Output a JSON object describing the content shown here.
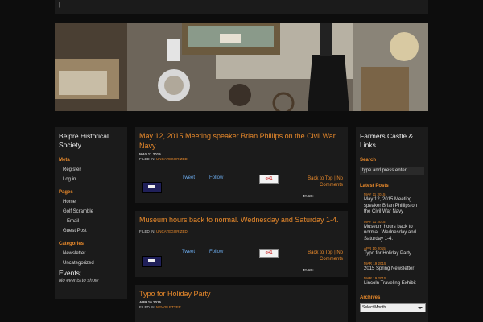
{
  "topbar": {
    "text": "|"
  },
  "left_sidebar": {
    "site_title": "Belpre Historical Society",
    "meta_title": "Meta",
    "meta_items": [
      "Register",
      "Log in"
    ],
    "pages_title": "Pages",
    "pages_items": [
      "Home",
      "Golf Scramble",
      "Email",
      "Guest Post"
    ],
    "categories_title": "Categories",
    "categories_items": [
      "Newsletter",
      "Uncategorized"
    ],
    "events_title": "Events;",
    "events_none": "No events to show"
  },
  "posts": [
    {
      "title": "May 12, 2015 Meeting speaker Brian Phillips on the Civil War Navy",
      "date": "MAY 11 2015",
      "filed_label": "FILED IN:",
      "category": "UNCATEGORIZED",
      "tweet": "Tweet",
      "follow": "Follow",
      "gplus": "g+1",
      "back_to_top": "Back to Top",
      "sep": "|",
      "no_comments": "No Comments",
      "tags": "TAGS:"
    },
    {
      "title": "Museum hours back to normal. Wednesday and Saturday 1-4.",
      "filed_label": "FILED IN:",
      "category": "UNCATEGORIZED",
      "tweet": "Tweet",
      "follow": "Follow",
      "gplus": "g+1",
      "back_to_top": "Back to Top",
      "sep": "|",
      "no_comments": "No Comments",
      "tags": "TAGS:"
    },
    {
      "title": "Typo for Holiday Party",
      "date": "APR 10 2015",
      "filed_label": "FILED IN:",
      "category": "NEWSLETTER"
    }
  ],
  "right_sidebar": {
    "title": "Farmers Castle & Links",
    "search_title": "Search",
    "search_placeholder": "type and press enter",
    "latest_title": "Latest Posts",
    "latest": [
      {
        "date": "MAY 11 2015",
        "title": "May 12, 2015 Meeting speaker Brian Phillips on the Civil War Navy"
      },
      {
        "date": "MAY 11 2015",
        "title": "Museum hours back to normal. Wednesday and Saturday 1-4."
      },
      {
        "date": "APR 10 2015",
        "title": "Typo for Holiday Party"
      },
      {
        "date": "MAR 19 2015",
        "title": "2015 Spring Newsletter"
      },
      {
        "date": "MAR 19 2015",
        "title": "Lincoln Traveling Exhibit"
      }
    ],
    "archives_title": "Archives",
    "archives_select": "Select Month"
  },
  "colors": {
    "accent": "#e8892b",
    "panel": "#1b1b1b",
    "background": "#0d0d0d",
    "social_link": "#6aa8e8"
  }
}
